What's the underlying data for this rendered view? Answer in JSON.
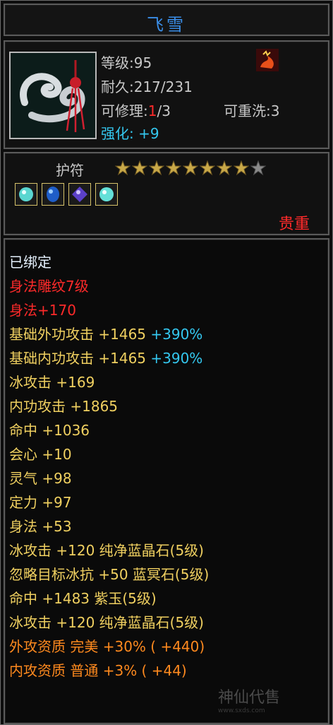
{
  "title": "飞雪",
  "info": {
    "level": "等级:95",
    "durability": "耐久:217/231",
    "repair_label": "可修理:",
    "repair_used": "1",
    "repair_total": "/3",
    "rewash": "可重洗:3",
    "enhance_label": "强化:",
    "enhance_value": "+9"
  },
  "amulet": {
    "label": "护符",
    "stars_filled": 8,
    "stars_total": 9,
    "rarity": "贵重"
  },
  "attributes": [
    {
      "text": "已绑定",
      "color": "white"
    },
    {
      "text": "身法雕纹7级",
      "color": "red"
    },
    {
      "text": "身法+170",
      "color": "red"
    },
    {
      "text": "基础外功攻击 +1465",
      "extra": " +390%",
      "color": "yellow"
    },
    {
      "text": "基础内功攻击 +1465",
      "extra": " +390%",
      "color": "yellow"
    },
    {
      "text": "冰攻击 +169",
      "color": "yellow"
    },
    {
      "text": "内功攻击 +1865",
      "color": "yellow"
    },
    {
      "text": "命中 +1036",
      "color": "yellow"
    },
    {
      "text": "会心 +10",
      "color": "yellow"
    },
    {
      "text": "灵气 +98",
      "color": "yellow"
    },
    {
      "text": "定力 +97",
      "color": "yellow"
    },
    {
      "text": "身法 +53",
      "color": "yellow"
    },
    {
      "text": "冰攻击 +120 纯净蓝晶石(5级)",
      "color": "yellow"
    },
    {
      "text": "忽略目标冰抗 +50 蓝冥石(5级)",
      "color": "yellow"
    },
    {
      "text": "命中 +1483 紫玉(5级)",
      "color": "yellow"
    },
    {
      "text": "冰攻击 +120 纯净蓝晶石(5级)",
      "color": "yellow"
    },
    {
      "text": "外攻资质  完美 +30% ( +440)",
      "color": "orange"
    },
    {
      "text": "内攻资质  普通 +3% ( +44)",
      "color": "orange"
    }
  ],
  "watermark": {
    "text": "神仙代售",
    "url": "www.sxds.com"
  }
}
